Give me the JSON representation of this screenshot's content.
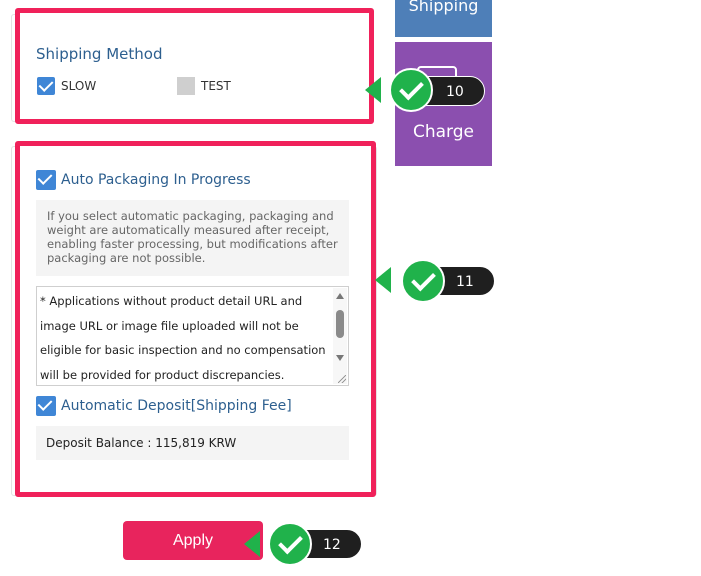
{
  "nav": {
    "shipping_label": "Shipping",
    "charge_label": "Charge"
  },
  "shipping_method": {
    "title": "Shipping Method",
    "options": [
      {
        "label": "SLOW",
        "checked": true
      },
      {
        "label": "TEST",
        "checked": false
      }
    ]
  },
  "packaging": {
    "auto_label": "Auto Packaging In Progress",
    "auto_checked": true,
    "info_text": "If you select automatic packaging, packaging and weight are automatically measured after receipt, enabling faster processing, but modifications after packaging are not possible.",
    "notice_text": "* Applications without product detail URL and image URL or image file uploaded will not be eligible for basic inspection and no compensation will be provided for product discrepancies."
  },
  "deposit": {
    "label": "Automatic Deposit[Shipping Fee]",
    "checked": true,
    "balance_text": "Deposit Balance : 115,819 KRW"
  },
  "apply_label": "Apply",
  "markers": [
    {
      "number": "10"
    },
    {
      "number": "11"
    },
    {
      "number": "12"
    }
  ],
  "colors": {
    "highlight": "#f0215a",
    "checkbox": "#3f86d6",
    "title": "#2d5f8f",
    "apply": "#e8245d",
    "marker": "#20b24b",
    "nav_shipping": "#4e7fb8",
    "nav_charge": "#8b4faf"
  }
}
